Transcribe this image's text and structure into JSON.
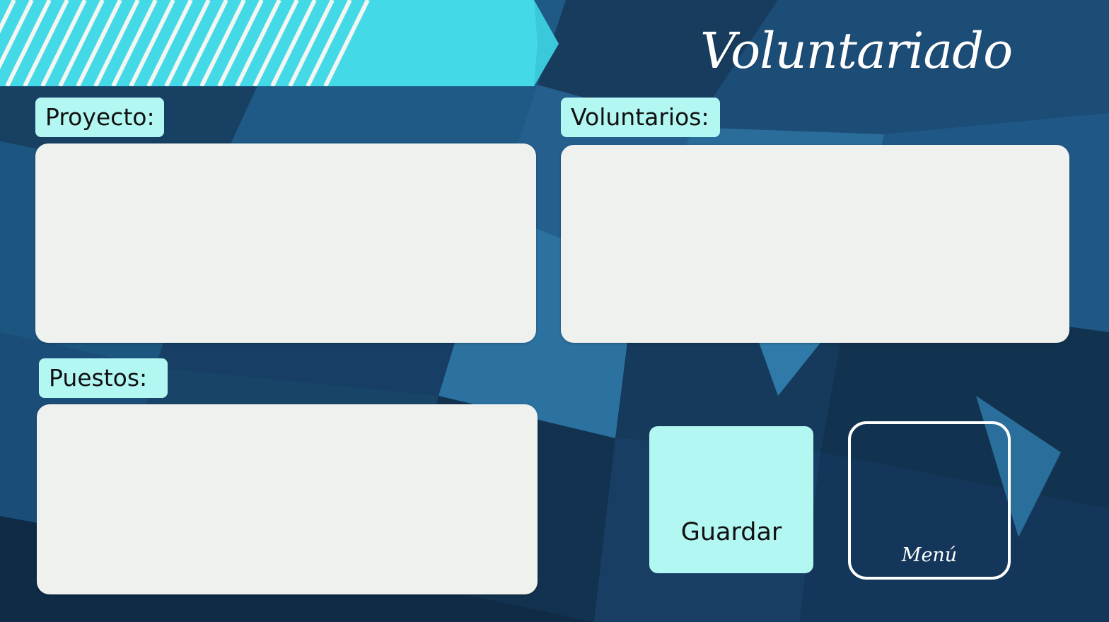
{
  "header": {
    "title": "Voluntariado"
  },
  "form": {
    "proyecto_label": "Proyecto:",
    "voluntarios_label": "Voluntarios:",
    "puestos_label": "Puestos:"
  },
  "actions": {
    "save_label": "Guardar",
    "menu_label": "Menú"
  },
  "colors": {
    "accent": "#44d9e6",
    "label_bg": "#b3f7f2",
    "panel_bg": "#eff1ee",
    "background": "#1a4a6e"
  }
}
